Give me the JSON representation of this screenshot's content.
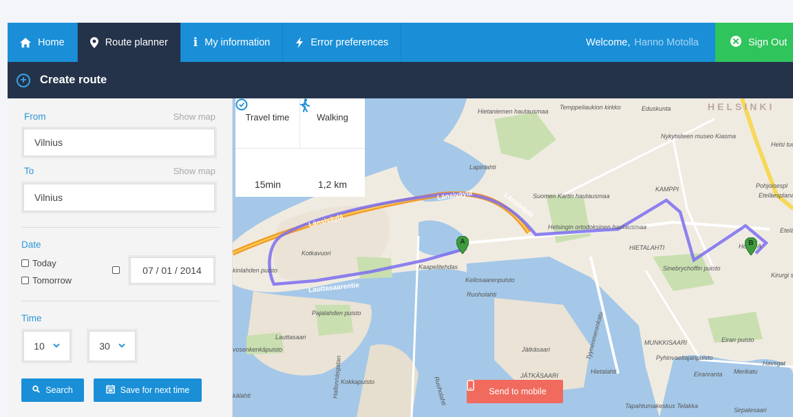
{
  "nav": {
    "home": "Home",
    "route_planner": "Route planner",
    "my_information": "My information",
    "error_preferences": "Error preferences",
    "welcome": "Welcome,",
    "user_name": "Hanno Motolla",
    "sign_out": "Sign Out"
  },
  "header": {
    "title": "Create route"
  },
  "form": {
    "from_label": "From",
    "from_show_map": "Show map",
    "from_value": "Vilnius",
    "to_label": "To",
    "to_show_map": "Show map",
    "to_value": "Vilnius",
    "date_label": "Date",
    "today": "Today",
    "tomorrow": "Tomorrow",
    "date_value": "07 / 01 / 2014",
    "time_label": "Time",
    "hour": "10",
    "minute": "30",
    "search": "Search",
    "save": "Save for next time"
  },
  "stats": {
    "travel_time_label": "Travel time",
    "walking_label": "Walking",
    "travel_time_value": "15min",
    "distance_value": "1,2 km"
  },
  "map": {
    "send_to_mobile": "Send to mobile",
    "marker_a": "A",
    "marker_b": "B",
    "labels": {
      "helsinki": "HELSINKI",
      "hietaniemen": "Hietaniemen hautausmaa",
      "temppeliaukion": "Temppeliaukion kirkko",
      "eduskunta": "Eduskunta",
      "nykytaiteen": "Nykytaiteen museo Kiasma",
      "lapinlahti": "Lapinlahti",
      "kamppi": "KAMPPI",
      "suomen_kartin": "Suomen Kartin hautausmaa",
      "helsingin": "Helsingin ortodoksinen hautausmaa",
      "hietalahti_n": "HIETALAHTI",
      "lansivayla1": "Länsiväylä",
      "lansivayla2": "Länsiväylä",
      "lansivayla3": "Länsiväylä",
      "kotkavuori": "Kotkavuori",
      "kaapelitehdas": "Kaapelitehdas",
      "kellosaarenpuisto": "Kellosaarenpuisto",
      "ruoholahti": "Ruoholahti",
      "lauttasaarentie": "Lauttasaarentie",
      "pajalahden": "Pajalahden puisto",
      "lauttasaari": "Lauttasaari",
      "vosenkenkapuisto": "vosenkenkäpuisto",
      "kinlahden": "kinlahden puisto",
      "kokkapuisto": "Kokkapuisto",
      "jatkasaari": "Jätkäsaari",
      "jatkasaari_n": "JÄTKÄSAARI",
      "tyynenmerenkatu": "Tyynenmerenkatu",
      "hietalahti": "Hietalahti",
      "sinebrychoffin": "Sinebrychoffin puisto",
      "munkkisaari": "MUNKKISAARI",
      "eiran": "Eiran puisto",
      "pyhinvaeltajanpuisto": "Pyhinvaeltajanpuisto",
      "hotelli": "Hotelli A",
      "etela": "Etelä",
      "pohjoisespl": "Pohjoisespl",
      "etelaesplanadi": "Eteläesplanadi",
      "kirurgi": "Kirurgi sairaala",
      "helsi": "Helsi tuomiok",
      "tapahtumakeskus": "Tapahtumakeskus Telakka",
      "sirpalesaari": "Sirpalesaari",
      "merikatu": "Merikatu",
      "havsgat": "Havsgat",
      "eiranranta": "Eiranranta",
      "kalahti": "kälahti",
      "hallonnasgatan": "Hallonnäsgatan",
      "ruoholahti_road": "Ruoholahti"
    }
  }
}
